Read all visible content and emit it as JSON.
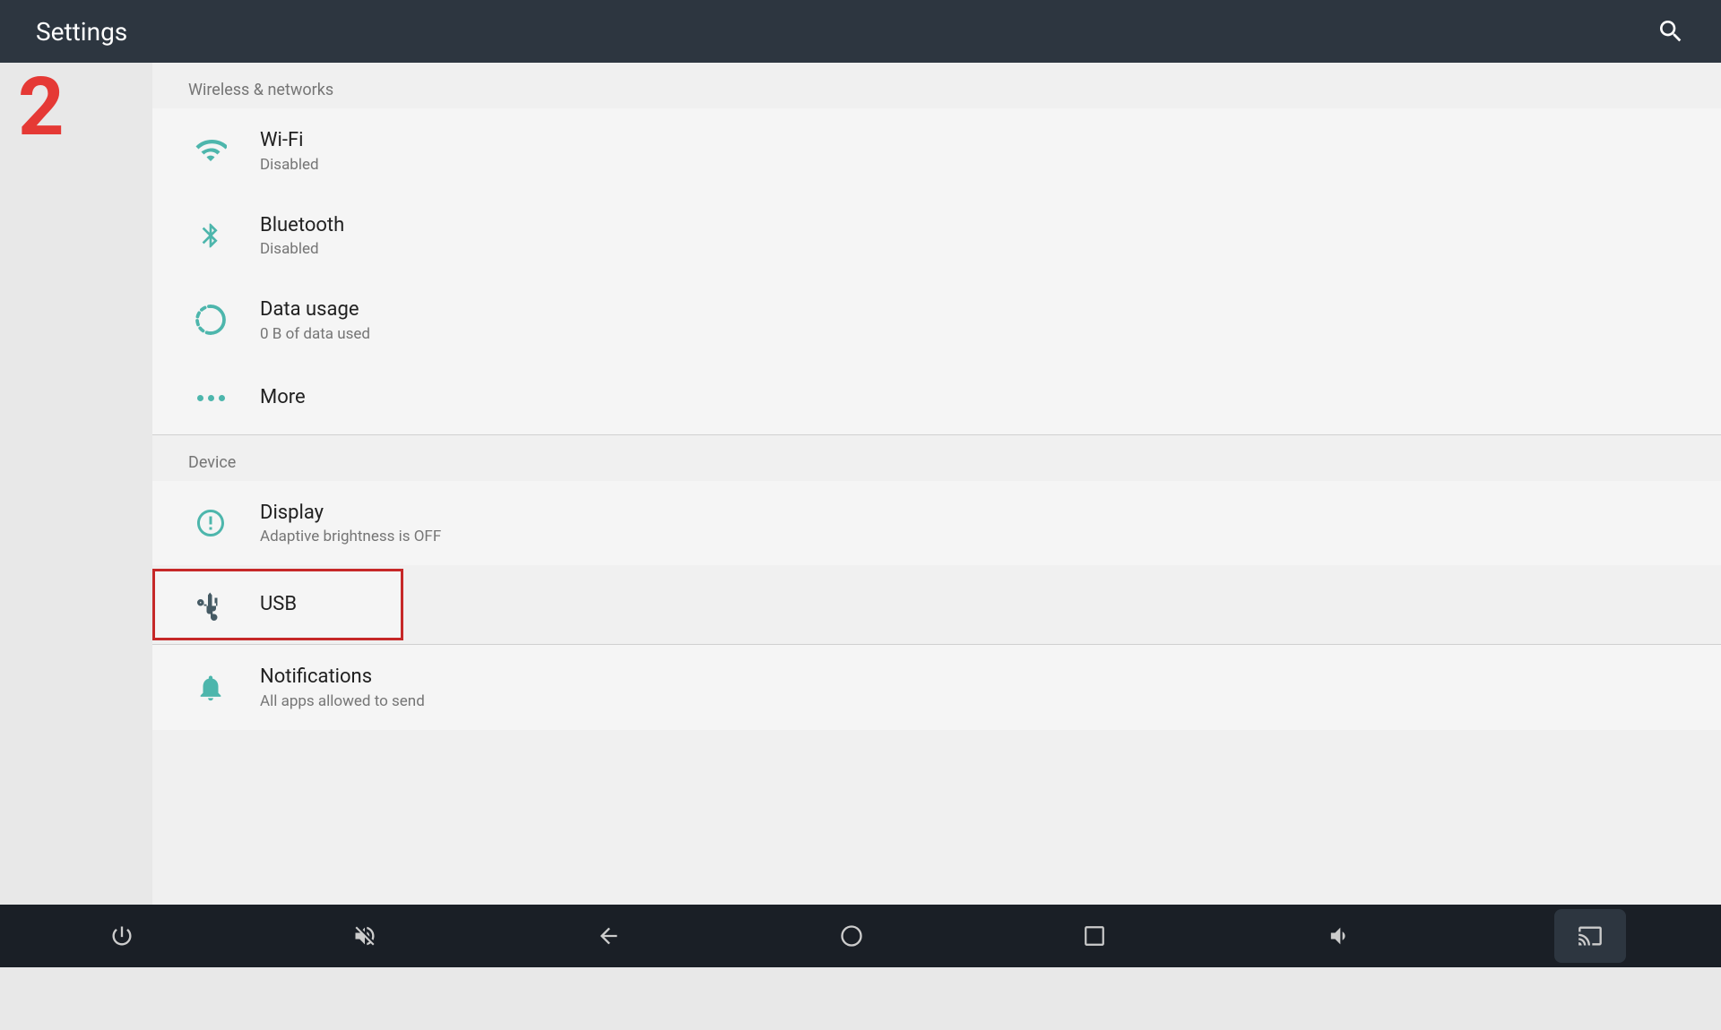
{
  "header": {
    "title": "Settings",
    "searchIconLabel": "search"
  },
  "sideNumber": "2",
  "sections": [
    {
      "id": "wireless",
      "header": "Wireless & networks",
      "items": [
        {
          "id": "wifi",
          "title": "Wi-Fi",
          "subtitle": "Disabled",
          "icon": "wifi"
        },
        {
          "id": "bluetooth",
          "title": "Bluetooth",
          "subtitle": "Disabled",
          "icon": "bluetooth"
        },
        {
          "id": "data-usage",
          "title": "Data usage",
          "subtitle": "0 B of data used",
          "icon": "data-usage"
        },
        {
          "id": "more",
          "title": "More",
          "subtitle": "",
          "icon": "more-dots"
        }
      ]
    },
    {
      "id": "device",
      "header": "Device",
      "items": [
        {
          "id": "display",
          "title": "Display",
          "subtitle": "Adaptive brightness is OFF",
          "icon": "display"
        },
        {
          "id": "usb",
          "title": "USB",
          "subtitle": "",
          "icon": "usb",
          "highlighted": true
        },
        {
          "id": "notifications",
          "title": "Notifications",
          "subtitle": "All apps allowed to send",
          "icon": "notifications"
        }
      ]
    }
  ],
  "bottomNav": {
    "items": [
      {
        "id": "power",
        "icon": "power"
      },
      {
        "id": "volume-mute",
        "icon": "volume-mute"
      },
      {
        "id": "back",
        "icon": "back"
      },
      {
        "id": "home",
        "icon": "home"
      },
      {
        "id": "recents",
        "icon": "recents"
      },
      {
        "id": "volume-down",
        "icon": "volume-down"
      },
      {
        "id": "screencast",
        "icon": "screencast"
      }
    ]
  }
}
